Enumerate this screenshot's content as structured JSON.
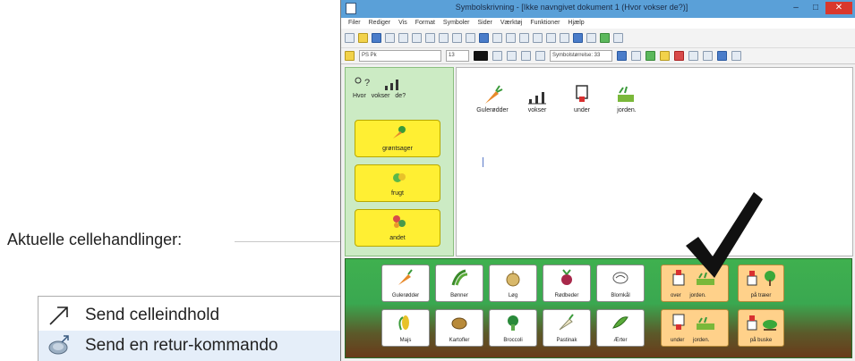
{
  "dialog": {
    "section_label": "Aktuelle cellehandlinger:",
    "actions": [
      {
        "label": "Send celleindhold",
        "icon": "arrow-up-right-icon"
      },
      {
        "label": "Send en retur-kommando",
        "icon": "return-command-icon"
      }
    ]
  },
  "app": {
    "title": "Symbolskrivning - [Ikke navngivet dokument 1 (Hvor vokser de?)]",
    "window_buttons": {
      "minimize": "–",
      "maximize": "□",
      "close": "✕"
    },
    "menu": [
      "Filer",
      "Rediger",
      "Vis",
      "Format",
      "Symboler",
      "Sider",
      "Værktøj",
      "Funktioner",
      "Hjælp"
    ],
    "toolbar": {
      "font_name": "PS Pk",
      "font_size": "13",
      "symbol_size": "Symbolstørrelse: 33"
    },
    "topic_panel": {
      "header_words": [
        "Hvor",
        "vokser",
        "de?"
      ],
      "buttons": [
        {
          "label": "grøntsager"
        },
        {
          "label": "frugt"
        },
        {
          "label": "andet"
        }
      ]
    },
    "document": {
      "words": [
        "Gulerødder",
        "vokser",
        "under",
        "jorden."
      ]
    },
    "grid": {
      "row1": [
        "Gulerødder",
        "Bønner",
        "Løg",
        "Rødbeder",
        "Blomkål"
      ],
      "row2": [
        "Majs",
        "Kartofler",
        "Broccoli",
        "Pastinak",
        "Ærter"
      ],
      "wide_row1": [
        {
          "label": "over jorden."
        },
        {
          "label": "på træer"
        }
      ],
      "wide_row2": [
        {
          "label": "under jorden."
        },
        {
          "label": "på buske"
        }
      ]
    }
  },
  "colors": {
    "titlebar": "#5aa0d8",
    "topic_panel": "#ccebc4",
    "topic_button": "#ffef33",
    "grid_green": "#3fb04f",
    "grid_brown": "#6a3a1a",
    "wide_cell": "#ffd18a",
    "checkmark": "#111111"
  }
}
